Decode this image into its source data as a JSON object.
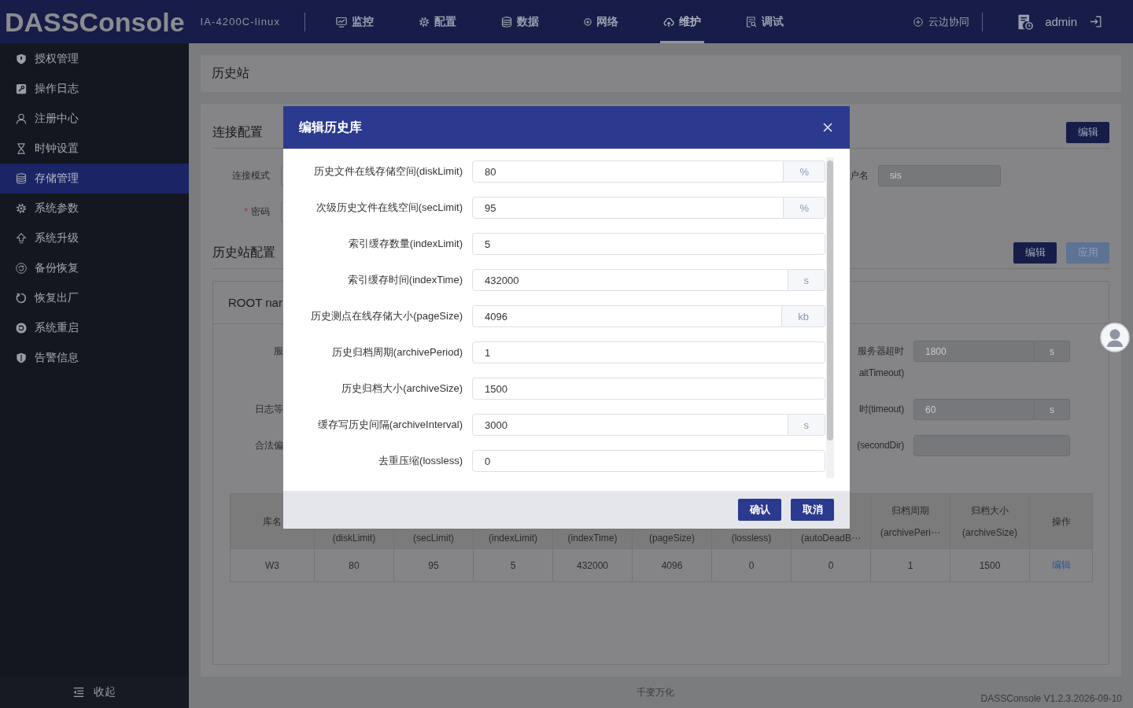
{
  "topbar": {
    "logo": "DASSConsole",
    "device": "IA-4200C-linux",
    "nav": [
      {
        "label": "监控",
        "selected": false
      },
      {
        "label": "配置",
        "selected": false
      },
      {
        "label": "数据",
        "selected": false
      },
      {
        "label": "网络",
        "selected": false
      },
      {
        "label": "维护",
        "selected": true
      },
      {
        "label": "调试",
        "selected": false
      }
    ],
    "cloud_link": "云边协同",
    "user": "admin"
  },
  "sidebar": {
    "items": [
      {
        "label": "授权管理",
        "selected": false
      },
      {
        "label": "操作日志",
        "selected": false
      },
      {
        "label": "注册中心",
        "selected": false
      },
      {
        "label": "时钟设置",
        "selected": false
      },
      {
        "label": "存储管理",
        "selected": true
      },
      {
        "label": "系统参数",
        "selected": false
      },
      {
        "label": "系统升级",
        "selected": false
      },
      {
        "label": "备份恢复",
        "selected": false
      },
      {
        "label": "恢复出厂",
        "selected": false
      },
      {
        "label": "系统重启",
        "selected": false
      },
      {
        "label": "告警信息",
        "selected": false
      }
    ],
    "collapse": "收起"
  },
  "breadcrumb": "历史站",
  "connection": {
    "title": "连接配置",
    "edit_button": "编辑",
    "rows": [
      {
        "left": {
          "label": "连接模式"
        },
        "right": {
          "label": "户名",
          "value": "sis",
          "disabled": true
        }
      },
      {
        "left": {
          "label": "密码",
          "required_mark": "*"
        }
      }
    ]
  },
  "history": {
    "title": "历史站配置",
    "buttons": [
      {
        "label": "编辑",
        "disabled": false
      },
      {
        "label": "应用",
        "disabled": true
      }
    ],
    "card": {
      "title": "ROOT nar",
      "rows": [
        {
          "left": "服",
          "right": {
            "label": [
              "服务器超时",
              "aitTimeout)"
            ],
            "value": "1800",
            "unit": "s",
            "disabled": true
          }
        },
        {
          "left": "日志等",
          "right": {
            "label": [
              "时(timeout)"
            ],
            "value": "60",
            "unit": "s",
            "disabled": true
          }
        },
        {
          "left": "合法偏",
          "right": {
            "label": [
              "(secondDir)"
            ],
            "disabled": true
          }
        }
      ],
      "table": {
        "columns": [
          {
            "title": "库名"
          },
          {
            "subtitle": "(diskLimit)"
          },
          {
            "subtitle": "(secLimit)"
          },
          {
            "subtitle": "(indexLimit)"
          },
          {
            "subtitle": "(indexTime)"
          },
          {
            "subtitle": "(pageSize)"
          },
          {
            "subtitle": "(lossless)"
          },
          {
            "subtitle": "(autoDeadB⋯"
          },
          {
            "title": "归档周期",
            "subtitle": "(archivePeri⋯"
          },
          {
            "title": "归档大小",
            "subtitle": "(archiveSize)"
          },
          {
            "title": "操作"
          }
        ],
        "rows": [
          {
            "cells": [
              "W3",
              "80",
              "95",
              "5",
              "432000",
              "4096",
              "0",
              "0",
              "1",
              "1500"
            ],
            "action": "编辑"
          }
        ]
      }
    }
  },
  "dialog": {
    "title": "编辑历史库",
    "fields": [
      {
        "label": "历史文件在线存储空间(diskLimit)",
        "value": "80",
        "unit": "%"
      },
      {
        "label": "次级历史文件在线空间(secLimit)",
        "value": "95",
        "unit": "%"
      },
      {
        "label": "索引缓存数量(indexLimit)",
        "value": "5"
      },
      {
        "label": "索引缓存时间(indexTime)",
        "value": "432000",
        "unit": "s"
      },
      {
        "label": "历史测点在线存储大小(pageSize)",
        "value": "4096",
        "unit": "kb"
      },
      {
        "label": "历史归档周期(archivePeriod)",
        "value": "1"
      },
      {
        "label": "历史归档大小(archiveSize)",
        "value": "1500"
      },
      {
        "label": "缓存写历史间隔(archiveInterval)",
        "value": "3000",
        "unit": "s"
      },
      {
        "label": "去重压缩(lossless)",
        "value": "0"
      }
    ],
    "buttons": [
      "确认",
      "取消"
    ]
  },
  "footer": {
    "slogan": "千变万化",
    "version": "DASSConsole V1.2.3.2026-09-10"
  }
}
